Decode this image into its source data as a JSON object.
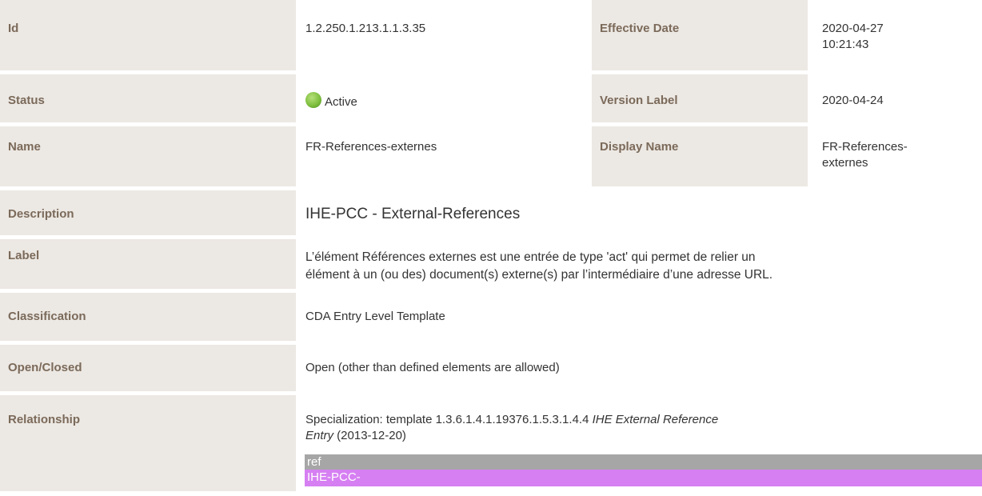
{
  "rows": {
    "id": {
      "label": "Id",
      "value": "1.2.250.1.213.1.1.3.35"
    },
    "effective_date": {
      "label": "Effective Date",
      "value_line1": "2020-04-27",
      "value_line2": "10:21:43"
    },
    "status": {
      "label": "Status",
      "value": "Active"
    },
    "version_label": {
      "label": "Version Label",
      "value": "2020-04-24"
    },
    "name": {
      "label": "Name",
      "value": "FR-References-externes"
    },
    "display_name": {
      "label": "Display Name",
      "value_line1": "FR-References-",
      "value_line2": "externes"
    },
    "description": {
      "label": "Description",
      "value": "IHE-PCC - External-References"
    },
    "label": {
      "label": "Label",
      "value_line1": "L’élément Références externes est une entrée de type 'act' qui permet de relier un",
      "value_line2": "élément à un (ou des) document(s) externe(s) par l’intermédiaire d’une adresse URL."
    },
    "classification": {
      "label": "Classification",
      "value": "CDA Entry Level Template"
    },
    "open_closed": {
      "label": "Open/Closed",
      "value": "Open (other than defined elements are allowed)"
    },
    "relationship": {
      "label": "Relationship",
      "prefix": "Specialization: template 1.3.6.1.4.1.19376.1.5.3.1.4.4 ",
      "template_name_line1": "IHE External Reference",
      "template_name_line2": "Entry",
      "date": " (2013-12-20)",
      "ref_tag": "ref",
      "ref_name": "IHE-PCC-"
    }
  },
  "colors": {
    "label_bg": "#ece8e3",
    "label_text": "#7b6a5a",
    "ref_bar": "#a6a6a6",
    "ihe_bar": "#d67ff2",
    "status_active": "#7fbf3f"
  },
  "icons": {
    "status": "status-active-dot-icon"
  }
}
